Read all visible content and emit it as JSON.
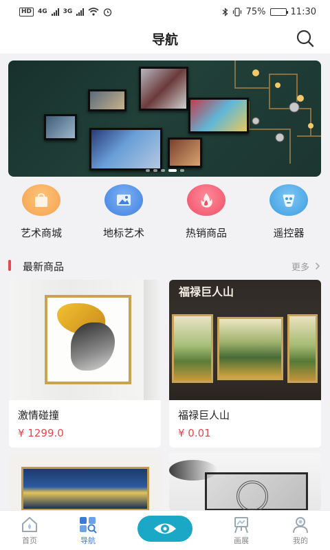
{
  "status_bar": {
    "left_chip": "HD",
    "net1": "4G",
    "net2": "3G",
    "battery": "75%",
    "battery_level": 0.75,
    "time": "11:30"
  },
  "header": {
    "title": "导航"
  },
  "banner": {
    "slide_count": 5,
    "active_index": 3
  },
  "categories": [
    {
      "label": "艺术商城",
      "icon": "shopping-bag-icon",
      "color": "#f6a553"
    },
    {
      "label": "地标艺术",
      "icon": "picture-icon",
      "color": "#4d8fe6"
    },
    {
      "label": "热销商品",
      "icon": "flame-icon",
      "color": "#f05b6e"
    },
    {
      "label": "遥控器",
      "icon": "remote-icon",
      "color": "#3fa3e6"
    }
  ],
  "section": {
    "title": "最新商品",
    "more": "更多"
  },
  "products": [
    {
      "name": "激情碰撞",
      "price": "¥ 1299.0"
    },
    {
      "name": "福禄巨人山",
      "price": "¥ 0.01",
      "image_caption": "福禄巨人山"
    },
    {
      "name": "",
      "price": ""
    },
    {
      "name": "",
      "price": ""
    }
  ],
  "tabbar": {
    "items": [
      {
        "label": "首页",
        "icon": "home-icon"
      },
      {
        "label": "导航",
        "icon": "grid-search-icon"
      },
      {
        "label": "",
        "icon": "eye-icon"
      },
      {
        "label": "画展",
        "icon": "easel-icon"
      },
      {
        "label": "我的",
        "icon": "user-icon"
      }
    ],
    "active_index": 1
  }
}
